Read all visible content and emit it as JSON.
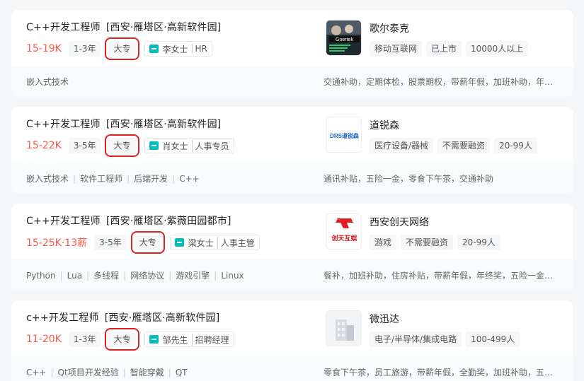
{
  "jobs": [
    {
      "title": "C++开发工程师",
      "location": "[西安·雁塔区·高新软件园]",
      "salary": "15-19K",
      "experience": "1-3年",
      "education": "大专",
      "recruiter_name": "李女士",
      "recruiter_role": "HR",
      "skills": [
        "嵌入式技术"
      ],
      "company_name": "歌尔泰克",
      "company_tags": [
        "移动互联网",
        "已上市",
        "10000人以上"
      ],
      "welfare": "交通补助，定期体检，股票期权，带薪年假，加班补助，年终奖",
      "logo_text": "Goertek"
    },
    {
      "title": "C++开发工程师",
      "location": "[西安·雁塔区·高新软件园]",
      "salary": "15-22K",
      "experience": "3-5年",
      "education": "大专",
      "recruiter_name": "肖女士",
      "recruiter_role": "人事专员",
      "skills": [
        "嵌入式技术",
        "软件工程师",
        "后端开发",
        "C++"
      ],
      "company_name": "道锐森",
      "company_tags": [
        "医疗设备/器械",
        "不需要融资",
        "20-99人"
      ],
      "welfare": "通讯补贴，五险一金，零食下午茶，交通补助",
      "logo_text": "DRS道锐森"
    },
    {
      "title": "C++开发工程师",
      "location": "[西安·雁塔区·紫薇田园都市]",
      "salary": "15-25K·13薪",
      "experience": "3-5年",
      "education": "大专",
      "recruiter_name": "梁女士",
      "recruiter_role": "人事主管",
      "skills": [
        "Python",
        "Lua",
        "多线程",
        "网络协议",
        "游戏引擎",
        "Linux"
      ],
      "company_name": "西安创天网络",
      "company_tags": [
        "游戏",
        "不需要融资",
        "20-99人"
      ],
      "welfare": "餐补，加班补助，住房补贴，带薪年假，年终奖，五险一金，定期体检",
      "logo_text": "创天互娱"
    },
    {
      "title": "c++开发工程师",
      "location": "[西安·雁塔区·高新软件园]",
      "salary": "11-20K",
      "experience": "1-3年",
      "education": "大专",
      "recruiter_name": "邹先生",
      "recruiter_role": "招聘经理",
      "skills": [
        "C++",
        "Qt项目开发经验",
        "智能穿戴",
        "QT"
      ],
      "company_name": "微迅达",
      "company_tags": [
        "电子/半导体/集成电路",
        "100-499人"
      ],
      "welfare": "零食下午茶，员工旅游，带薪年假，全勤奖，加班补助，五险一金",
      "logo_text": ""
    }
  ],
  "colors": {
    "salary": "#fe574a",
    "highlight_box": "#e02020",
    "chat_icon": "#00bebd"
  }
}
